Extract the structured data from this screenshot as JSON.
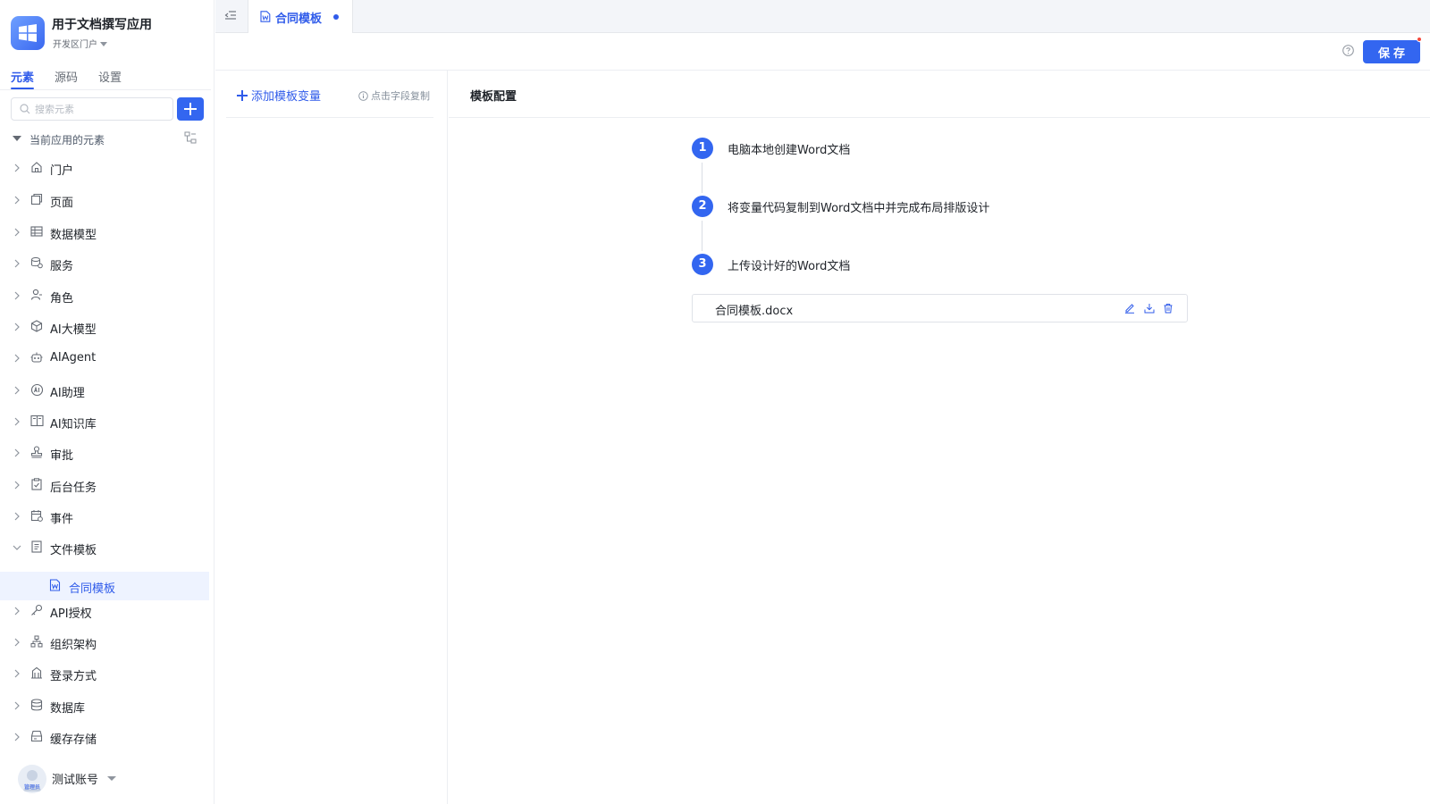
{
  "sidebar": {
    "app_title": "用于文档撰写应用",
    "portal_label": "开发区门户",
    "tabs": [
      "元素",
      "源码",
      "设置"
    ],
    "search_placeholder": "搜索元素",
    "section_label": "当前应用的元素",
    "items": [
      {
        "label": "门户",
        "icon": "home-icon"
      },
      {
        "label": "页面",
        "icon": "page-icon"
      },
      {
        "label": "数据模型",
        "icon": "table-icon"
      },
      {
        "label": "服务",
        "icon": "service-icon"
      },
      {
        "label": "角色",
        "icon": "role-icon"
      },
      {
        "label": "AI大模型",
        "icon": "cube-icon"
      },
      {
        "label": "AIAgent",
        "icon": "robot-icon"
      },
      {
        "label": "AI助理",
        "icon": "ai-icon"
      },
      {
        "label": "AI知识库",
        "icon": "book-icon"
      },
      {
        "label": "审批",
        "icon": "stamp-icon"
      },
      {
        "label": "后台任务",
        "icon": "task-icon"
      },
      {
        "label": "事件",
        "icon": "calendar-icon"
      },
      {
        "label": "文件模板",
        "icon": "doc-icon"
      },
      {
        "label": "合同模板",
        "icon": "word-icon"
      },
      {
        "label": "API授权",
        "icon": "key-icon"
      },
      {
        "label": "组织架构",
        "icon": "org-icon"
      },
      {
        "label": "登录方式",
        "icon": "bank-icon"
      },
      {
        "label": "数据库",
        "icon": "database-icon"
      },
      {
        "label": "缓存存储",
        "icon": "storage-icon"
      }
    ],
    "user": {
      "name": "测试账号",
      "badge": "管理员"
    }
  },
  "tabbar": {
    "active_tab": "合同模板"
  },
  "toolbar": {
    "save_label": "保存"
  },
  "variables": {
    "add_label": "添加模板变量",
    "copy_hint": "点击字段复制"
  },
  "config": {
    "title": "模板配置",
    "steps": [
      {
        "num": "1",
        "text": "电脑本地创建Word文档"
      },
      {
        "num": "2",
        "text": "将变量代码复制到Word文档中并完成布局排版设计"
      },
      {
        "num": "3",
        "text": "上传设计好的Word文档"
      }
    ],
    "file_name": "合同模板.docx"
  },
  "colors": {
    "accent": "#3366f0",
    "selected_bg": "#eef3ff",
    "unsaved_dot": "#f5483b"
  }
}
